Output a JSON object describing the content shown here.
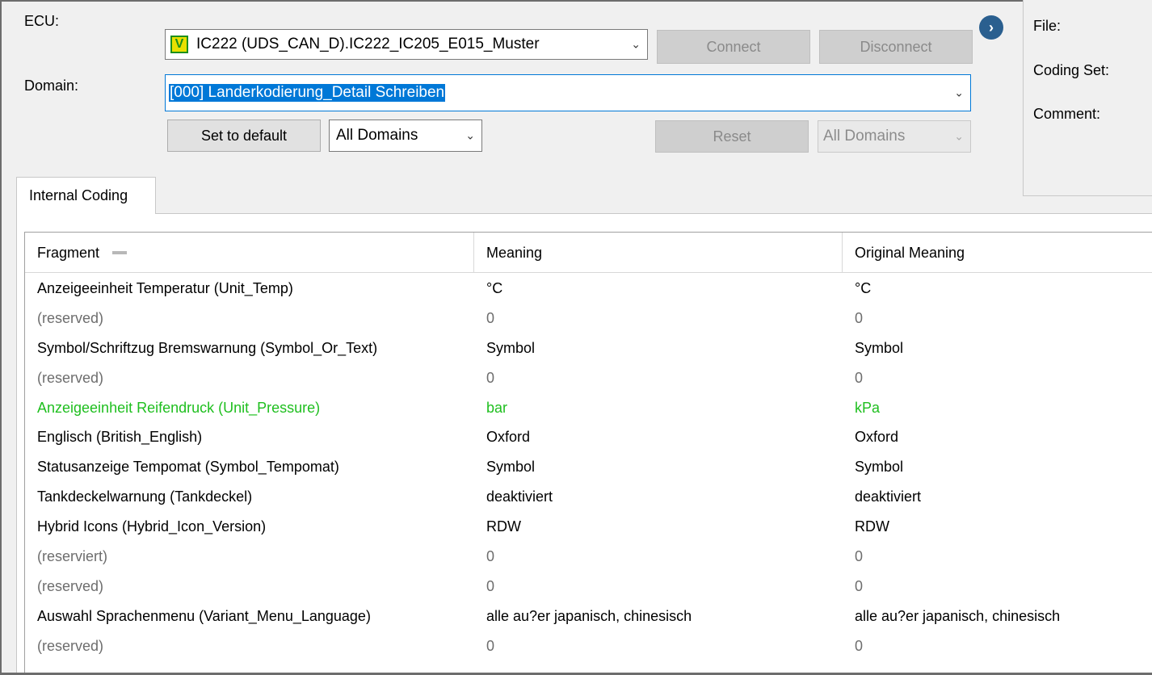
{
  "form": {
    "ecu_label": "ECU:",
    "ecu_value": "IC222 (UDS_CAN_D).IC222_IC205_E015_Muster",
    "ecu_badge": "V",
    "connect_label": "Connect",
    "disconnect_label": "Disconnect",
    "domain_label": "Domain:",
    "domain_value": "[000] Landerkodierung_Detail Schreiben",
    "set_default_label": "Set to default",
    "domains_filter_left": "All Domains",
    "reset_label": "Reset",
    "domains_filter_right": "All Domains"
  },
  "side": {
    "file_label": "File:",
    "coding_set_label": "Coding Set:",
    "comment_label": "Comment:"
  },
  "tabs": [
    {
      "label": "Internal Coding"
    }
  ],
  "table": {
    "columns": [
      "Fragment",
      "Meaning",
      "Original Meaning"
    ],
    "rows": [
      {
        "fragment": "Anzeigeeinheit Temperatur (Unit_Temp)",
        "meaning": "°C",
        "original": "°C"
      },
      {
        "fragment": "(reserved)",
        "meaning": "0",
        "original": "0"
      },
      {
        "fragment": "Symbol/Schriftzug Bremswarnung (Symbol_Or_Text)",
        "meaning": "Symbol",
        "original": "Symbol"
      },
      {
        "fragment": "(reserved)",
        "meaning": "0",
        "original": "0"
      },
      {
        "fragment": "Anzeigeeinheit Reifendruck (Unit_Pressure)",
        "meaning": "bar",
        "original": "kPa"
      },
      {
        "fragment": "Englisch (British_English)",
        "meaning": "Oxford",
        "original": "Oxford"
      },
      {
        "fragment": "Statusanzeige Tempomat (Symbol_Tempomat)",
        "meaning": "Symbol",
        "original": "Symbol"
      },
      {
        "fragment": "Tankdeckelwarnung (Tankdeckel)",
        "meaning": "deaktiviert",
        "original": "deaktiviert"
      },
      {
        "fragment": "Hybrid Icons (Hybrid_Icon_Version)",
        "meaning": "RDW",
        "original": "RDW"
      },
      {
        "fragment": "(reserviert)",
        "meaning": "0",
        "original": "0"
      },
      {
        "fragment": "(reserved)",
        "meaning": "0",
        "original": "0"
      },
      {
        "fragment": "Auswahl Sprachenmenu (Variant_Menu_Language)",
        "meaning": "alle au?er japanisch, chinesisch",
        "original": "alle au?er japanisch, chinesisch"
      },
      {
        "fragment": "(reserved)",
        "meaning": "0",
        "original": "0"
      }
    ]
  },
  "colors": {
    "changed_row": "#1fbf1f",
    "reserved_row": "#6d6d6d",
    "selection": "#0078d7"
  }
}
